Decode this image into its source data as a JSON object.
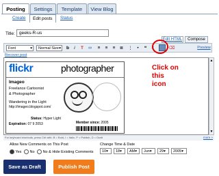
{
  "tabs": [
    {
      "label": "Posting"
    },
    {
      "label": "Settings"
    },
    {
      "label": "Template"
    },
    {
      "label": "View Blog"
    }
  ],
  "subtabs": {
    "create": "Create",
    "edit_posts": "Edit posts",
    "status": "Status"
  },
  "title_field": {
    "label": "Title:",
    "value": "geeks-R-us"
  },
  "editor_tabs": {
    "edit_html": "Edit HTML",
    "compose": "Compose"
  },
  "toolbar": {
    "font": "Font",
    "normal_size": "Normal Size",
    "bold": "b",
    "italic": "i",
    "link": "link",
    "preview": "Preview",
    "recover_post": "Recover post"
  },
  "card": {
    "flickr": "flickr",
    "photographer": "photographer",
    "name": "Imageo",
    "line1": "Freelance Cartoonist",
    "line2": "& Photographer",
    "line3": "Wandering in the Light",
    "url": "http://imageo.blogspot.com/",
    "status_label": "Status:",
    "status_value": "Hyper Light",
    "expiration_label": "Expiration:",
    "expiration_value": "07 9 2053",
    "member_since_label": "Member since:",
    "member_since_value": "2005"
  },
  "annotation": {
    "line1": "Click on",
    "line2": "this",
    "line3": "icon",
    "color": "#e00000"
  },
  "shortcut_hint": "For keyboard shortcuts, press Ctrl with: B = Bold, I = Italic, P = Publish, D = Draft",
  "shortcut_more": "more »",
  "comments": {
    "label": "Allow New Comments on This Post",
    "yes": "Yes",
    "no": "No",
    "hide": "No & Hide Existing Comments"
  },
  "datetime": {
    "label": "Change Time & Date",
    "hour": "10",
    "minute": "18",
    "ampm": "AM",
    "month": "Jun",
    "day": "29",
    "year": "2005"
  },
  "buttons": {
    "save_draft": "Save as Draft",
    "publish": "Publish Post"
  },
  "colors": {
    "draft_btn": "#1a2f6e",
    "publish_btn": "#f07c1c",
    "accent": "#1a5fb4"
  }
}
